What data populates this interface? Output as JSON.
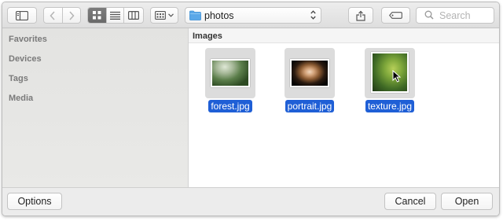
{
  "toolbar": {
    "path": {
      "folder_name": "photos",
      "folder_icon": "folder-icon",
      "folder_color": "#5aa8e8"
    },
    "search": {
      "placeholder": "Search"
    }
  },
  "sidebar": {
    "sections": [
      {
        "label": "Favorites"
      },
      {
        "label": "Devices"
      },
      {
        "label": "Tags"
      },
      {
        "label": "Media"
      }
    ]
  },
  "main": {
    "group_title": "Images",
    "files": [
      {
        "name": "forest.jpg",
        "selected": true
      },
      {
        "name": "portrait.jpg",
        "selected": true
      },
      {
        "name": "texture.jpg",
        "selected": true
      }
    ],
    "selection_color": "#1f5fd6"
  },
  "footer": {
    "options_label": "Options",
    "cancel_label": "Cancel",
    "open_label": "Open"
  }
}
